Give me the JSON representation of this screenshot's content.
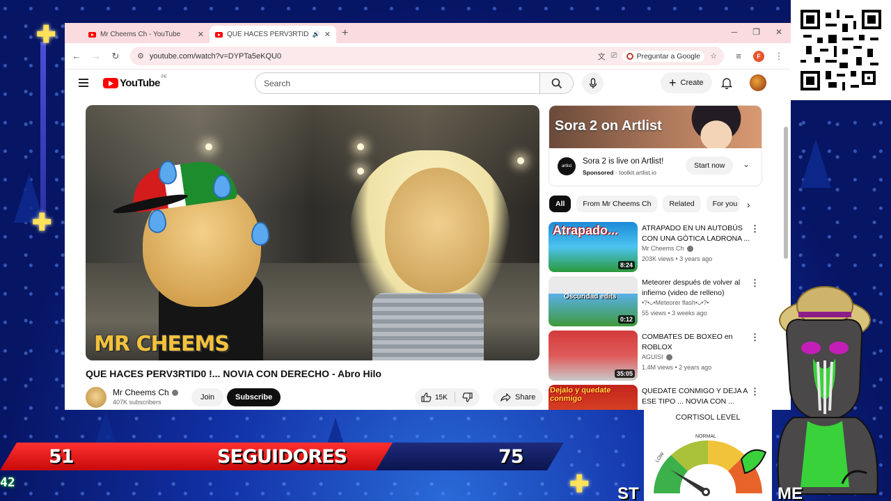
{
  "browser": {
    "tabs": [
      {
        "title": "Mr Cheems Ch - YouTube",
        "active": false
      },
      {
        "title": "QUE HACES PERV3RTID0 !...",
        "active": true
      }
    ],
    "url": "youtube.com/watch?v=DYPTa5eKQU0",
    "ask_google": "Preguntar a Google",
    "profile_initial": "F"
  },
  "youtube": {
    "logo_text": "YouTube",
    "region": "PE",
    "search_placeholder": "Search",
    "create_label": "Create",
    "video": {
      "overlay_text_a": "MR",
      "overlay_text_b": "CHEEMS",
      "title": "QUE HACES PERV3RTID0 !... NOVIA CON DERECHO - Abro Hilo"
    },
    "channel": {
      "name": "Mr Cheems Ch",
      "subscribers": "407K subscribers",
      "join": "Join",
      "subscribe": "Subscribe"
    },
    "actions": {
      "likes": "15K",
      "share": "Share"
    },
    "ad": {
      "headline": "Sora 2 on Artlist",
      "logo": "artlist",
      "text": "Sora 2 is live on Artlist!",
      "sponsored": "Sponsored",
      "domain": "toolkit.artlist.io",
      "cta": "Start now"
    },
    "chips": [
      "All",
      "From Mr Cheems Ch",
      "Related",
      "For you"
    ],
    "recommendations": [
      {
        "title": "ATRAPADO EN UN AUTOBÚS CON UNA GÓTICA LADRONA ...",
        "channel": "Mr Cheems Ch",
        "meta": "203K views • 3 years ago",
        "duration": "8:24",
        "thumb_text": "Atrapado..."
      },
      {
        "title": "Meteorer después de volver al infierno (video de relleno)",
        "channel": "•?•ᴗ•Meteorer flash•ᴗ•?•",
        "meta": "55 views • 3 weeks ago",
        "duration": "0:12",
        "thumb_text": "Oscuridad edits"
      },
      {
        "title": "COMBATES DE BOXEO en ROBLOX",
        "channel": "AGUISI",
        "meta": "1.4M views • 2 years ago",
        "duration": "35:05",
        "thumb_text": ""
      },
      {
        "title": "QUEDATE CONMIGO Y DEJA A ESE TIPO ... NOVIA CON ...",
        "channel": "",
        "meta": "",
        "duration": "",
        "thumb_text": "Dejalo y quedate conmigo"
      }
    ]
  },
  "overlay": {
    "followers_current": "51",
    "followers_label": "SEGUIDORES",
    "followers_goal": "75",
    "ticker": "42",
    "stream_tag_left": "ST",
    "stream_tag_right": "ME",
    "cortisol_title": "CORTISOL LEVEL",
    "gauge_low": "LOW",
    "gauge_normal": "NORMAL",
    "gauge_value_fraction": 0.18
  },
  "colors": {
    "youtube_red": "#ff0000",
    "follow_bar_red": "#e01414",
    "tab_bar": "#fadce0",
    "overlay_blue": "#0b1f86"
  }
}
